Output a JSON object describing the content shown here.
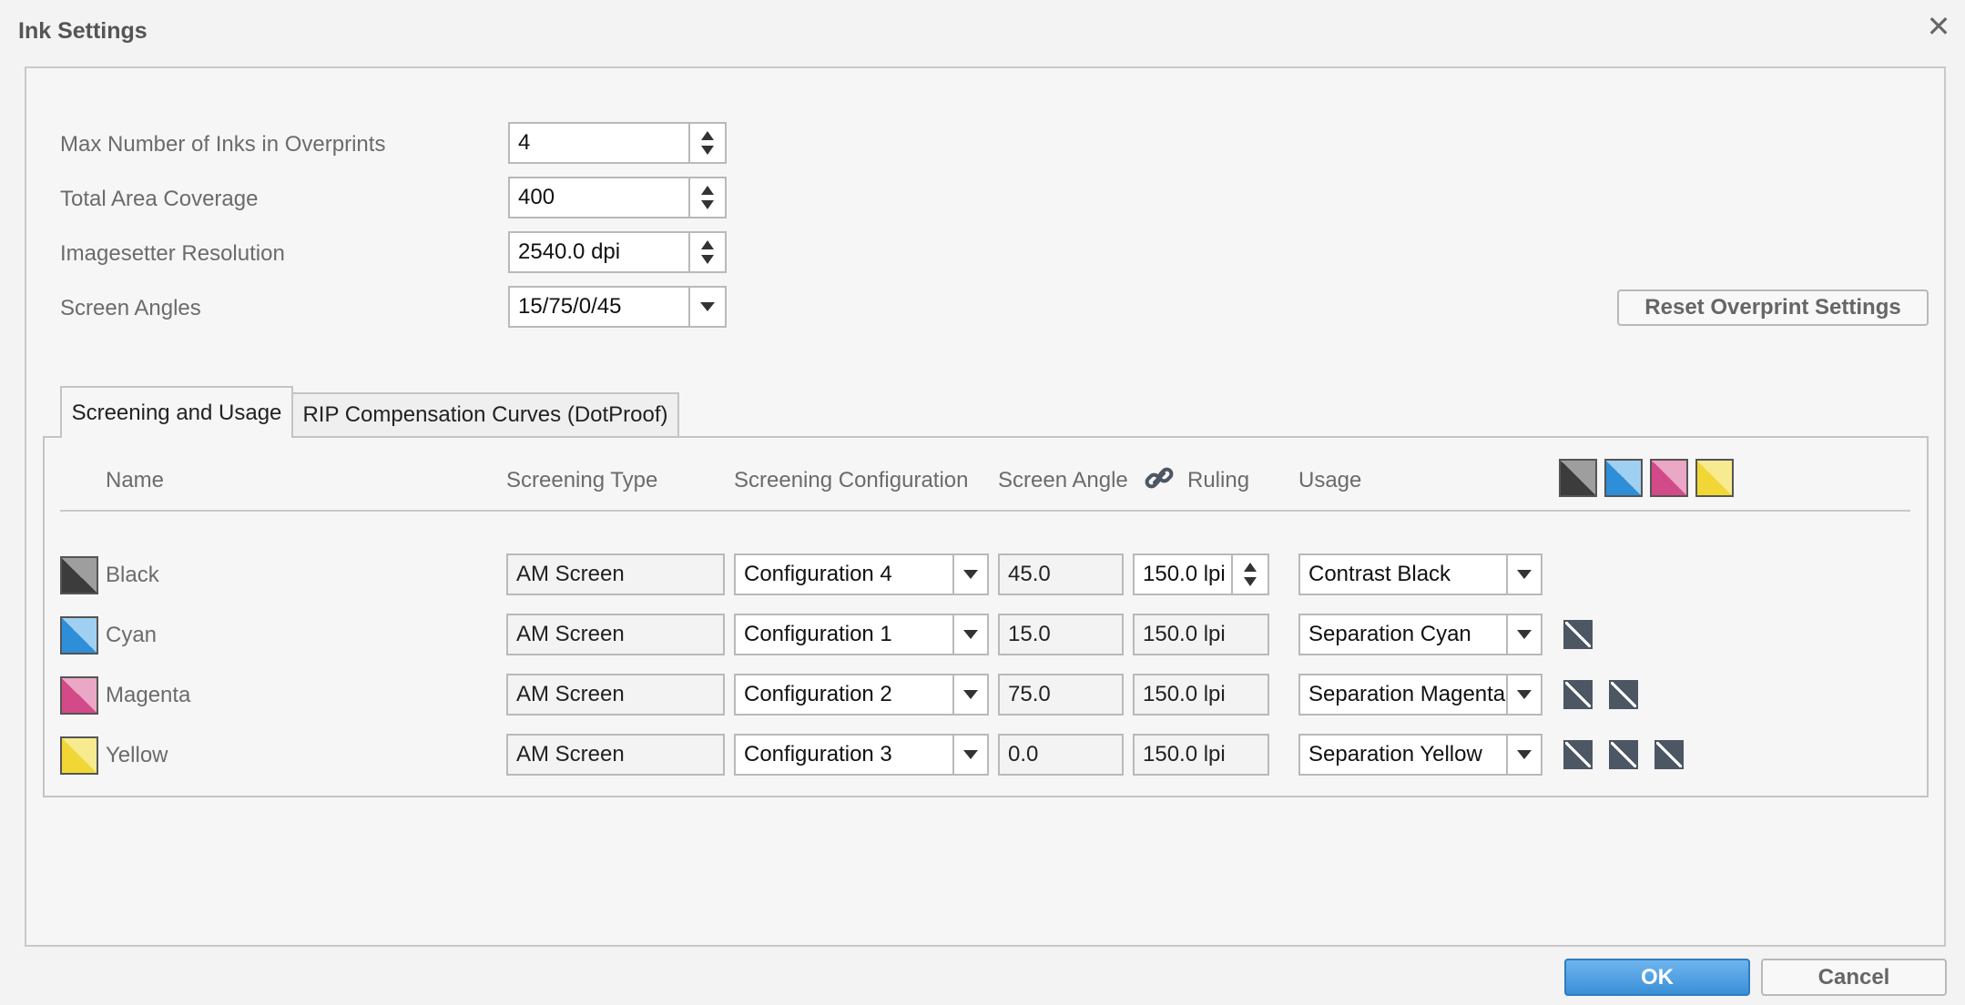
{
  "window": {
    "title": "Ink Settings",
    "close_glyph": "✕"
  },
  "settings": {
    "max_inks": {
      "label": "Max Number of Inks in Overprints",
      "value": "4"
    },
    "tac": {
      "label": "Total Area Coverage",
      "value": "400"
    },
    "resolution": {
      "label": "Imagesetter Resolution",
      "value": "2540.0 dpi"
    },
    "screen_angles": {
      "label": "Screen Angles",
      "value": "15/75/0/45"
    }
  },
  "reset_button": "Reset Overprint Settings",
  "tabs": [
    {
      "label": "Screening and Usage",
      "active": true
    },
    {
      "label": "RIP Compensation Curves (DotProof)",
      "active": false
    }
  ],
  "columns": {
    "name": "Name",
    "screening_type": "Screening Type",
    "screening_config": "Screening Configuration",
    "screen_angle": "Screen Angle",
    "ruling": "Ruling",
    "usage": "Usage"
  },
  "icons": {
    "link": "link-icon",
    "spin_up": "arrow-up-icon",
    "spin_down": "arrow-down-icon",
    "dropdown": "chevron-down-icon"
  },
  "colors": {
    "black": "#555555",
    "cyan": "#3a96dc",
    "magenta": "#d85892",
    "yellow": "#f2da3a",
    "accent": "#3a8fd8"
  },
  "inks": [
    {
      "name": "Black",
      "swatch": "black",
      "screening_type": "AM Screen",
      "config": "Configuration 4",
      "angle": "45.0",
      "ruling": "150.0 lpi",
      "usage": "Contrast Black",
      "overprint_count": 0
    },
    {
      "name": "Cyan",
      "swatch": "cyan",
      "screening_type": "AM Screen",
      "config": "Configuration 1",
      "angle": "15.0",
      "ruling": "150.0 lpi",
      "usage": "Separation Cyan",
      "overprint_count": 1
    },
    {
      "name": "Magenta",
      "swatch": "magenta",
      "screening_type": "AM Screen",
      "config": "Configuration 2",
      "angle": "75.0",
      "ruling": "150.0 lpi",
      "usage": "Separation Magenta",
      "overprint_count": 2
    },
    {
      "name": "Yellow",
      "swatch": "yellow",
      "screening_type": "AM Screen",
      "config": "Configuration 3",
      "angle": "0.0",
      "ruling": "150.0 lpi",
      "usage": "Separation Yellow",
      "overprint_count": 3
    }
  ],
  "footer": {
    "ok": "OK",
    "cancel": "Cancel"
  }
}
